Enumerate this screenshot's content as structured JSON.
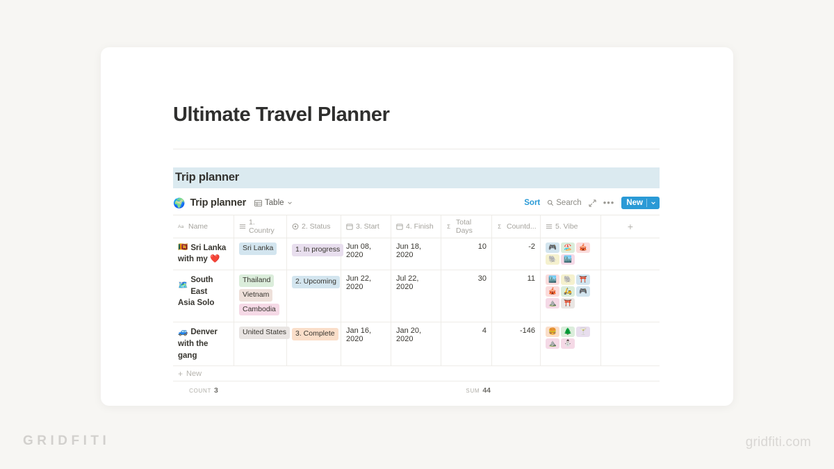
{
  "page": {
    "title": "Ultimate Travel Planner",
    "section_heading": "Trip planner"
  },
  "watermarks": {
    "left": "GRIDFITI",
    "right": "gridfiti.com"
  },
  "database": {
    "emoji": "🌍",
    "name": "Trip planner",
    "view_label": "Table",
    "view_icon": "table-icon",
    "chevron_icon": "chevron-down-icon",
    "toolbar": {
      "sort_label": "Sort",
      "search_label": "Search",
      "search_icon": "search-icon",
      "expand_icon": "expand-icon",
      "more_label": "•••",
      "new_label": "New",
      "new_chevron_icon": "chevron-down-icon",
      "accent_color": "#2a9ad6"
    },
    "columns": [
      {
        "label": "Name",
        "icon": "title-text-icon"
      },
      {
        "label": "1. Country",
        "icon": "multi-select-icon"
      },
      {
        "label": "2. Status",
        "icon": "select-icon"
      },
      {
        "label": "3. Start",
        "icon": "date-icon"
      },
      {
        "label": "4. Finish",
        "icon": "date-icon"
      },
      {
        "label": "Total Days",
        "icon": "formula-sigma-icon"
      },
      {
        "label": "Countd...",
        "icon": "formula-sigma-icon"
      },
      {
        "label": "5. Vibe",
        "icon": "multi-select-icon"
      }
    ],
    "add_column_label": "+",
    "rows": [
      {
        "emoji": "🇱🇰",
        "name_line1": "Sri Lanka",
        "name_line2": "with my ❤️",
        "country": [
          {
            "label": "Sri Lanka",
            "color": "#d3e5ef"
          }
        ],
        "status": {
          "label": "1. In progress",
          "color": "#e8deee"
        },
        "start": "Jun 08, 2020",
        "finish": "Jun 18, 2020",
        "total_days": "10",
        "countdown": "-2",
        "vibe": [
          {
            "emoji": "🎮",
            "color": "#d3e5ef"
          },
          {
            "emoji": "🏖️",
            "color": "#dbeddb"
          },
          {
            "emoji": "🎪",
            "color": "#fbdcdc"
          },
          {
            "emoji": "🐘",
            "color": "#f5f1ce"
          },
          {
            "emoji": "🏙️",
            "color": "#f5d9e6"
          }
        ]
      },
      {
        "emoji": "🗺️",
        "name_line1": "South East",
        "name_line2": "Asia Solo",
        "country": [
          {
            "label": "Thailand",
            "color": "#dbeddb"
          },
          {
            "label": "Vietnam",
            "color": "#eee0da"
          },
          {
            "label": "Cambodia",
            "color": "#f5d9e6"
          }
        ],
        "status": {
          "label": "2. Upcoming",
          "color": "#d3e5ef"
        },
        "start": "Jun 22, 2020",
        "finish": "Jul 22, 2020",
        "total_days": "30",
        "countdown": "11",
        "vibe": [
          {
            "emoji": "🏙️",
            "color": "#fbdcdc"
          },
          {
            "emoji": "🐘",
            "color": "#f5f1ce"
          },
          {
            "emoji": "⛩️",
            "color": "#d3e5ef"
          },
          {
            "emoji": "🎪",
            "color": "#fbdcdc"
          },
          {
            "emoji": "🛵",
            "color": "#dbeddb"
          },
          {
            "emoji": "🎮",
            "color": "#d3e5ef"
          },
          {
            "emoji": "⛰️",
            "color": "#f5d9e6"
          },
          {
            "emoji": "⛩️",
            "color": "#e9e5e3"
          }
        ]
      },
      {
        "emoji": "🚙",
        "name_line1": "Denver",
        "name_line2": "with the gang",
        "country": [
          {
            "label": "United States",
            "color": "#e9e5e3"
          }
        ],
        "status": {
          "label": "3. Complete",
          "color": "#fadec9"
        },
        "start": "Jan 16, 2020",
        "finish": "Jan 20, 2020",
        "total_days": "4",
        "countdown": "-146",
        "vibe": [
          {
            "emoji": "🍔",
            "color": "#fadec9"
          },
          {
            "emoji": "🌲",
            "color": "#dbeddb"
          },
          {
            "emoji": "🍸",
            "color": "#e8deee"
          },
          {
            "emoji": "⛰️",
            "color": "#f5d9e6"
          },
          {
            "emoji": "⛄",
            "color": "#f5d9e6"
          }
        ]
      }
    ],
    "new_row_label": "New",
    "new_row_icon": "plus-icon",
    "aggregates": {
      "count_label": "COUNT",
      "count_value": "3",
      "sum_label": "SUM",
      "sum_value": "44"
    }
  }
}
